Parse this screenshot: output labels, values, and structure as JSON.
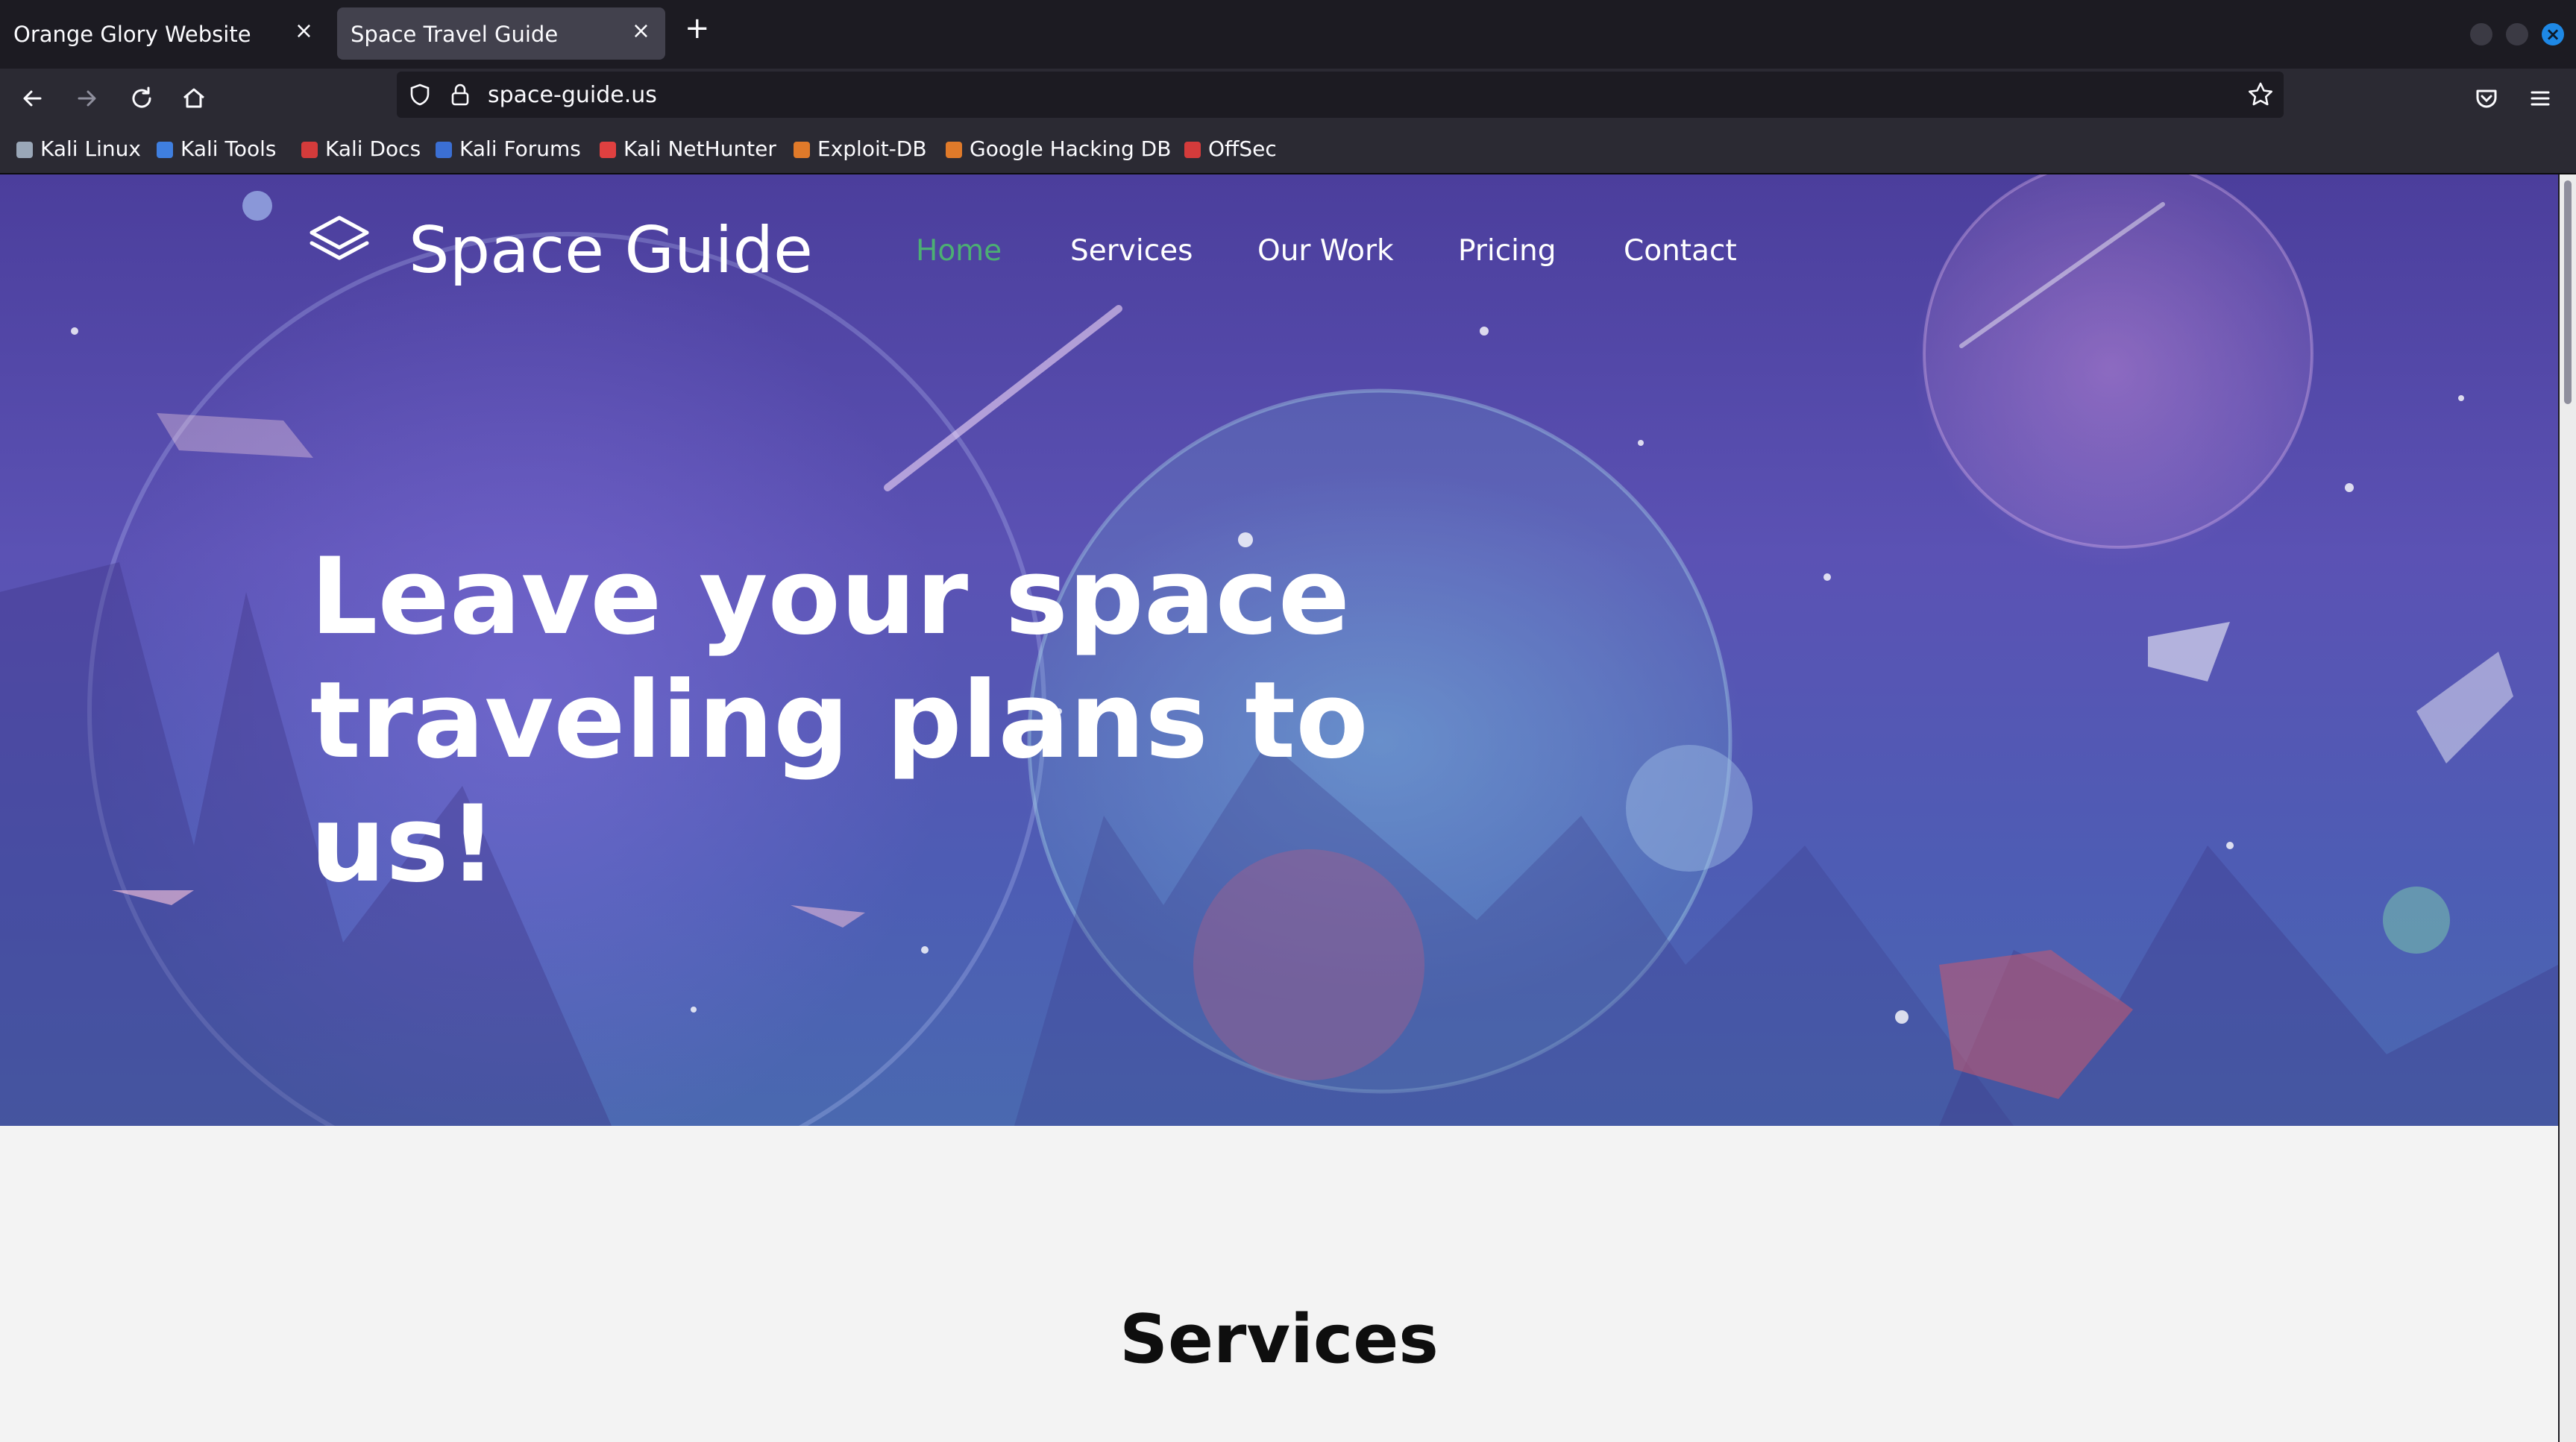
{
  "browser": {
    "tabs": [
      {
        "title": "Orange Glory Website",
        "close": "×"
      },
      {
        "title": "Space Travel Guide",
        "close": "×"
      }
    ],
    "new_tab": "+",
    "url": "space-guide.us",
    "bookmarks": [
      {
        "label": "Kali Linux",
        "color": "#9aa7b8"
      },
      {
        "label": "Kali Tools",
        "color": "#3f7fe0"
      },
      {
        "label": "Kali Docs",
        "color": "#d43b3b"
      },
      {
        "label": "Kali Forums",
        "color": "#3b6fd4"
      },
      {
        "label": "Kali NetHunter",
        "color": "#e04040"
      },
      {
        "label": "Exploit-DB",
        "color": "#e07a2a"
      },
      {
        "label": "Google Hacking DB",
        "color": "#e07a2a"
      },
      {
        "label": "OffSec",
        "color": "#d43b3b"
      }
    ],
    "icons": [
      "back-icon",
      "forward-icon",
      "reload-icon",
      "home-icon",
      "shield-icon",
      "lock-icon",
      "star-icon",
      "pocket-icon",
      "menu-icon"
    ]
  },
  "site": {
    "brand": "Space Guide",
    "nav": [
      "Home",
      "Services",
      "Our Work",
      "Pricing",
      "Contact"
    ],
    "active_nav": "Home",
    "headline_line1": "Leave your space",
    "headline_line2": "traveling plans to us!",
    "services_heading": "Services",
    "accent_color": "#4caf73"
  }
}
